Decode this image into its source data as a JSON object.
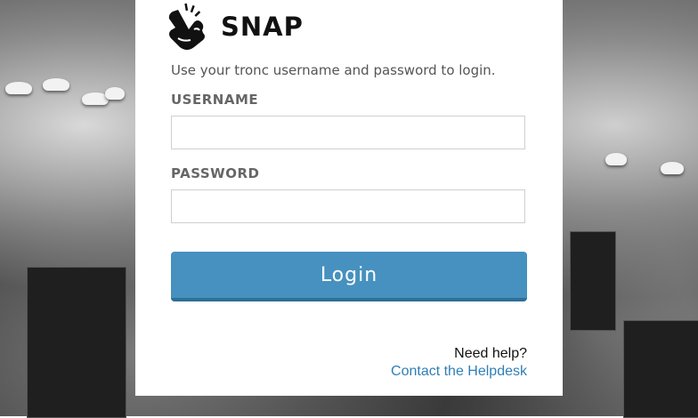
{
  "brand": {
    "name": "SNAP",
    "logo_icon": "snapping-hand-icon"
  },
  "login": {
    "intro": "Use your tronc username and password to login.",
    "username_label": "USERNAME",
    "username_value": "",
    "password_label": "PASSWORD",
    "password_value": "",
    "submit_label": "Login"
  },
  "help": {
    "question": "Need help?",
    "link_text": "Contact the Helpdesk"
  },
  "colors": {
    "button": "#4691bf",
    "link": "#2f7fb7",
    "panel": "#ffffff"
  }
}
